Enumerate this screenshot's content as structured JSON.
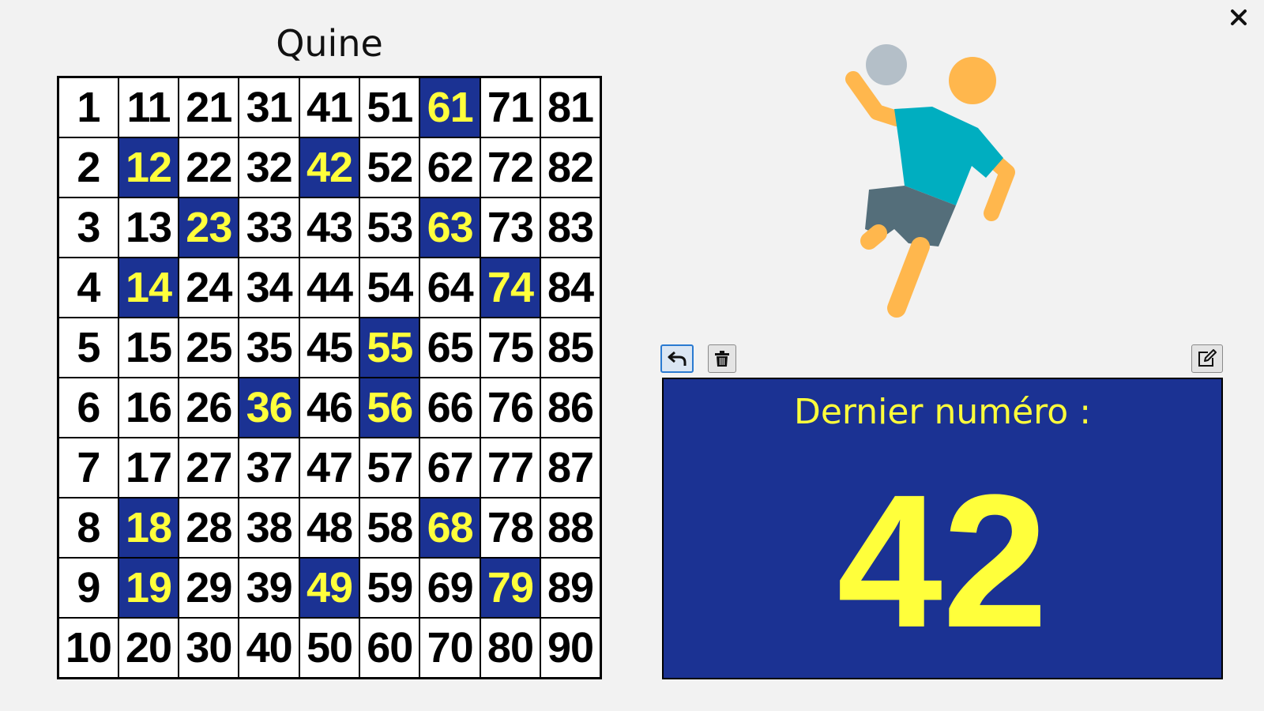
{
  "title": "Quine",
  "grid": {
    "rows": [
      [
        "1",
        "11",
        "21",
        "31",
        "41",
        "51",
        "61",
        "71",
        "81"
      ],
      [
        "2",
        "12",
        "22",
        "32",
        "42",
        "52",
        "62",
        "72",
        "82"
      ],
      [
        "3",
        "13",
        "23",
        "33",
        "43",
        "53",
        "63",
        "73",
        "83"
      ],
      [
        "4",
        "14",
        "24",
        "34",
        "44",
        "54",
        "64",
        "74",
        "84"
      ],
      [
        "5",
        "15",
        "25",
        "35",
        "45",
        "55",
        "65",
        "75",
        "85"
      ],
      [
        "6",
        "16",
        "26",
        "36",
        "46",
        "56",
        "66",
        "76",
        "86"
      ],
      [
        "7",
        "17",
        "27",
        "37",
        "47",
        "57",
        "67",
        "77",
        "87"
      ],
      [
        "8",
        "18",
        "28",
        "38",
        "48",
        "58",
        "68",
        "78",
        "88"
      ],
      [
        "9",
        "19",
        "29",
        "39",
        "49",
        "59",
        "69",
        "79",
        "89"
      ],
      [
        "10",
        "20",
        "30",
        "40",
        "50",
        "60",
        "70",
        "80",
        "90"
      ]
    ],
    "drawn": [
      "12",
      "14",
      "18",
      "19",
      "23",
      "36",
      "42",
      "49",
      "55",
      "56",
      "61",
      "63",
      "68",
      "74",
      "79"
    ]
  },
  "last_number": {
    "label": "Dernier numéro :",
    "value": "42"
  },
  "toolbar": {
    "undo_icon": "undo-arrow-icon",
    "delete_icon": "trash-icon",
    "edit_icon": "edit-icon"
  },
  "window": {
    "close_icon": "close-icon"
  },
  "illustration": {
    "icon": "handball-player-icon"
  },
  "colors": {
    "drawn_bg": "#1b3293",
    "drawn_text": "#ffff3b",
    "panel_bg": "#1b3293"
  }
}
